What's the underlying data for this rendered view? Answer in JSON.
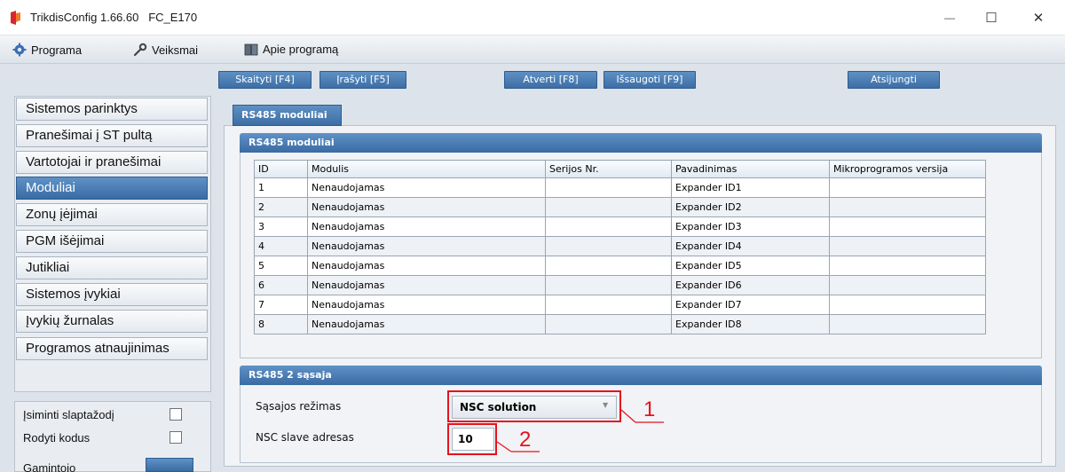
{
  "window": {
    "title": "TrikdisConfig 1.66.60   FC_E170",
    "minimize_glyph": "—",
    "maximize_glyph": "☐",
    "close_glyph": "✕"
  },
  "menu": {
    "programa": "Programa",
    "veiksmai": "Veiksmai",
    "apie": "Apie programą"
  },
  "toolbar": {
    "read": "Skaityti [F4]",
    "write": "Įrašyti [F5]",
    "open": "Atverti [F8]",
    "save": "Išsaugoti [F9]",
    "disconnect": "Atsijungti"
  },
  "sidebar": {
    "items": [
      {
        "label": "Sistemos parinktys",
        "active": false
      },
      {
        "label": "Pranešimai į ST pultą",
        "active": false
      },
      {
        "label": "Vartotojai ir pranešimai",
        "active": false
      },
      {
        "label": "Moduliai",
        "active": true
      },
      {
        "label": "Zonų įėjimai",
        "active": false
      },
      {
        "label": "PGM išėjimai",
        "active": false
      },
      {
        "label": "Jutikliai",
        "active": false
      },
      {
        "label": "Sistemos įvykiai",
        "active": false
      },
      {
        "label": "Įvykių žurnalas",
        "active": false
      },
      {
        "label": "Programos atnaujinimas",
        "active": false
      }
    ]
  },
  "options": {
    "remember_password": "Įsiminti slaptažodį",
    "show_codes": "Rodyti kodus",
    "manufacturer": "Gamintojo"
  },
  "main": {
    "tab": "RS485 moduliai",
    "modules_group": {
      "title": "RS485 moduliai",
      "columns": [
        "ID",
        "Modulis",
        "Serijos Nr.",
        "Pavadinimas",
        "Mikroprogramos versija"
      ],
      "rows": [
        [
          "1",
          "Nenaudojamas",
          "",
          "Expander ID1",
          ""
        ],
        [
          "2",
          "Nenaudojamas",
          "",
          "Expander ID2",
          ""
        ],
        [
          "3",
          "Nenaudojamas",
          "",
          "Expander ID3",
          ""
        ],
        [
          "4",
          "Nenaudojamas",
          "",
          "Expander ID4",
          ""
        ],
        [
          "5",
          "Nenaudojamas",
          "",
          "Expander ID5",
          ""
        ],
        [
          "6",
          "Nenaudojamas",
          "",
          "Expander ID6",
          ""
        ],
        [
          "7",
          "Nenaudojamas",
          "",
          "Expander ID7",
          ""
        ],
        [
          "8",
          "Nenaudojamas",
          "",
          "Expander ID8",
          ""
        ]
      ]
    },
    "interface_group": {
      "title": "RS485 2 sąsaja",
      "mode_label": "Sąsajos režimas",
      "mode_value": "NSC solution",
      "address_label": "NSC slave adresas",
      "address_value": "10"
    }
  },
  "annotations": {
    "marker_1": "1",
    "marker_2": "2",
    "color": "#e8121c"
  },
  "colors": {
    "accent": "#3d6ea5",
    "annotation": "#e8121c"
  }
}
